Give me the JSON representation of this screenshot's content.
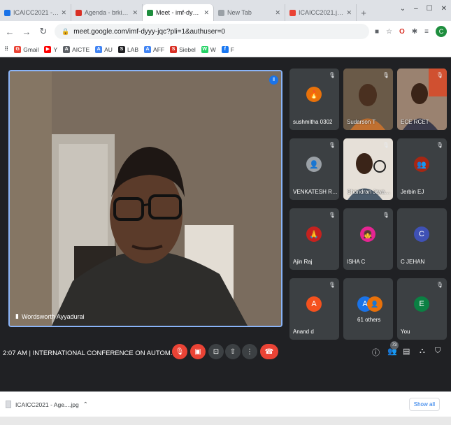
{
  "browser": {
    "tabs": [
      {
        "label": "ICAICC2021 - Agenda",
        "color": "#1a73e8",
        "active": false
      },
      {
        "label": "Agenda - brkiel.cl@gmail...",
        "color": "#d93025",
        "active": false
      },
      {
        "label": "Meet - imf-dyyy-jqc",
        "color": "#1e8e3e",
        "active": true
      },
      {
        "label": "New Tab",
        "color": "#9aa0a6",
        "active": false
      },
      {
        "label": "ICAICC2021.jpg - Goo...",
        "color": "#ea4335",
        "active": false
      }
    ],
    "new_tab_symbol": "+",
    "window_controls": [
      "⌄",
      "–",
      "☐",
      "✕"
    ],
    "url": "meet.google.com/imf-dyyy-jqc?pli=1&authuser=0",
    "profile_initial": "C",
    "bookmarks": [
      {
        "label": "Gmail",
        "icon": "G",
        "color": "#ea4335"
      },
      {
        "label": "Y",
        "icon": "▶",
        "color": "#ff0000"
      },
      {
        "label": "AICTE",
        "icon": "A",
        "color": "#5f6368"
      },
      {
        "label": "AU",
        "icon": "A",
        "color": "#4285f4"
      },
      {
        "label": "LAB",
        "icon": "S",
        "color": "#202124"
      },
      {
        "label": "AFF",
        "icon": "A",
        "color": "#4285f4"
      },
      {
        "label": "Siebel",
        "icon": "S",
        "color": "#d93025"
      },
      {
        "label": "W",
        "icon": "W",
        "color": "#25d366"
      },
      {
        "label": "F",
        "icon": "f",
        "color": "#1877f2"
      }
    ]
  },
  "meet": {
    "main_speaker": "Wordsworth Ayyadurai",
    "participants": [
      {
        "name": "sushmitha 0302",
        "type": "avatar",
        "initial": "S",
        "color": "#e8710a"
      },
      {
        "name": "Sudarson T",
        "type": "video"
      },
      {
        "name": "ECE RCET",
        "type": "video"
      },
      {
        "name": "VENKATESH RAJ...",
        "type": "avatar",
        "initial": "V",
        "color": "#9aa0a6"
      },
      {
        "name": "Chandran Jayak...",
        "type": "video"
      },
      {
        "name": "Jerbin EJ",
        "type": "avatar",
        "initial": "J",
        "color": "#a52714"
      },
      {
        "name": "Ajin Raj",
        "type": "avatar",
        "initial": "A",
        "color": "#c5221f"
      },
      {
        "name": "ISHA C",
        "type": "avatar",
        "initial": "I",
        "color": "#e52592"
      },
      {
        "name": "C JEHAN",
        "type": "letter",
        "initial": "C",
        "color": "#3f51b5"
      },
      {
        "name": "Anand d",
        "type": "letter",
        "initial": "A",
        "color": "#f4511e"
      },
      {
        "name": "61 others",
        "type": "others",
        "initial": "A",
        "color": "#1a73e8"
      },
      {
        "name": "You",
        "type": "letter",
        "initial": "E",
        "color": "#0b8043"
      }
    ],
    "meeting_info": "2:07 AM  |  INTERNATIONAL CONFERENCE ON AUTOM...",
    "participant_count": "73"
  },
  "downloads": {
    "file": "ICAICC2021 - Age....jpg",
    "show_all": "Show all"
  }
}
